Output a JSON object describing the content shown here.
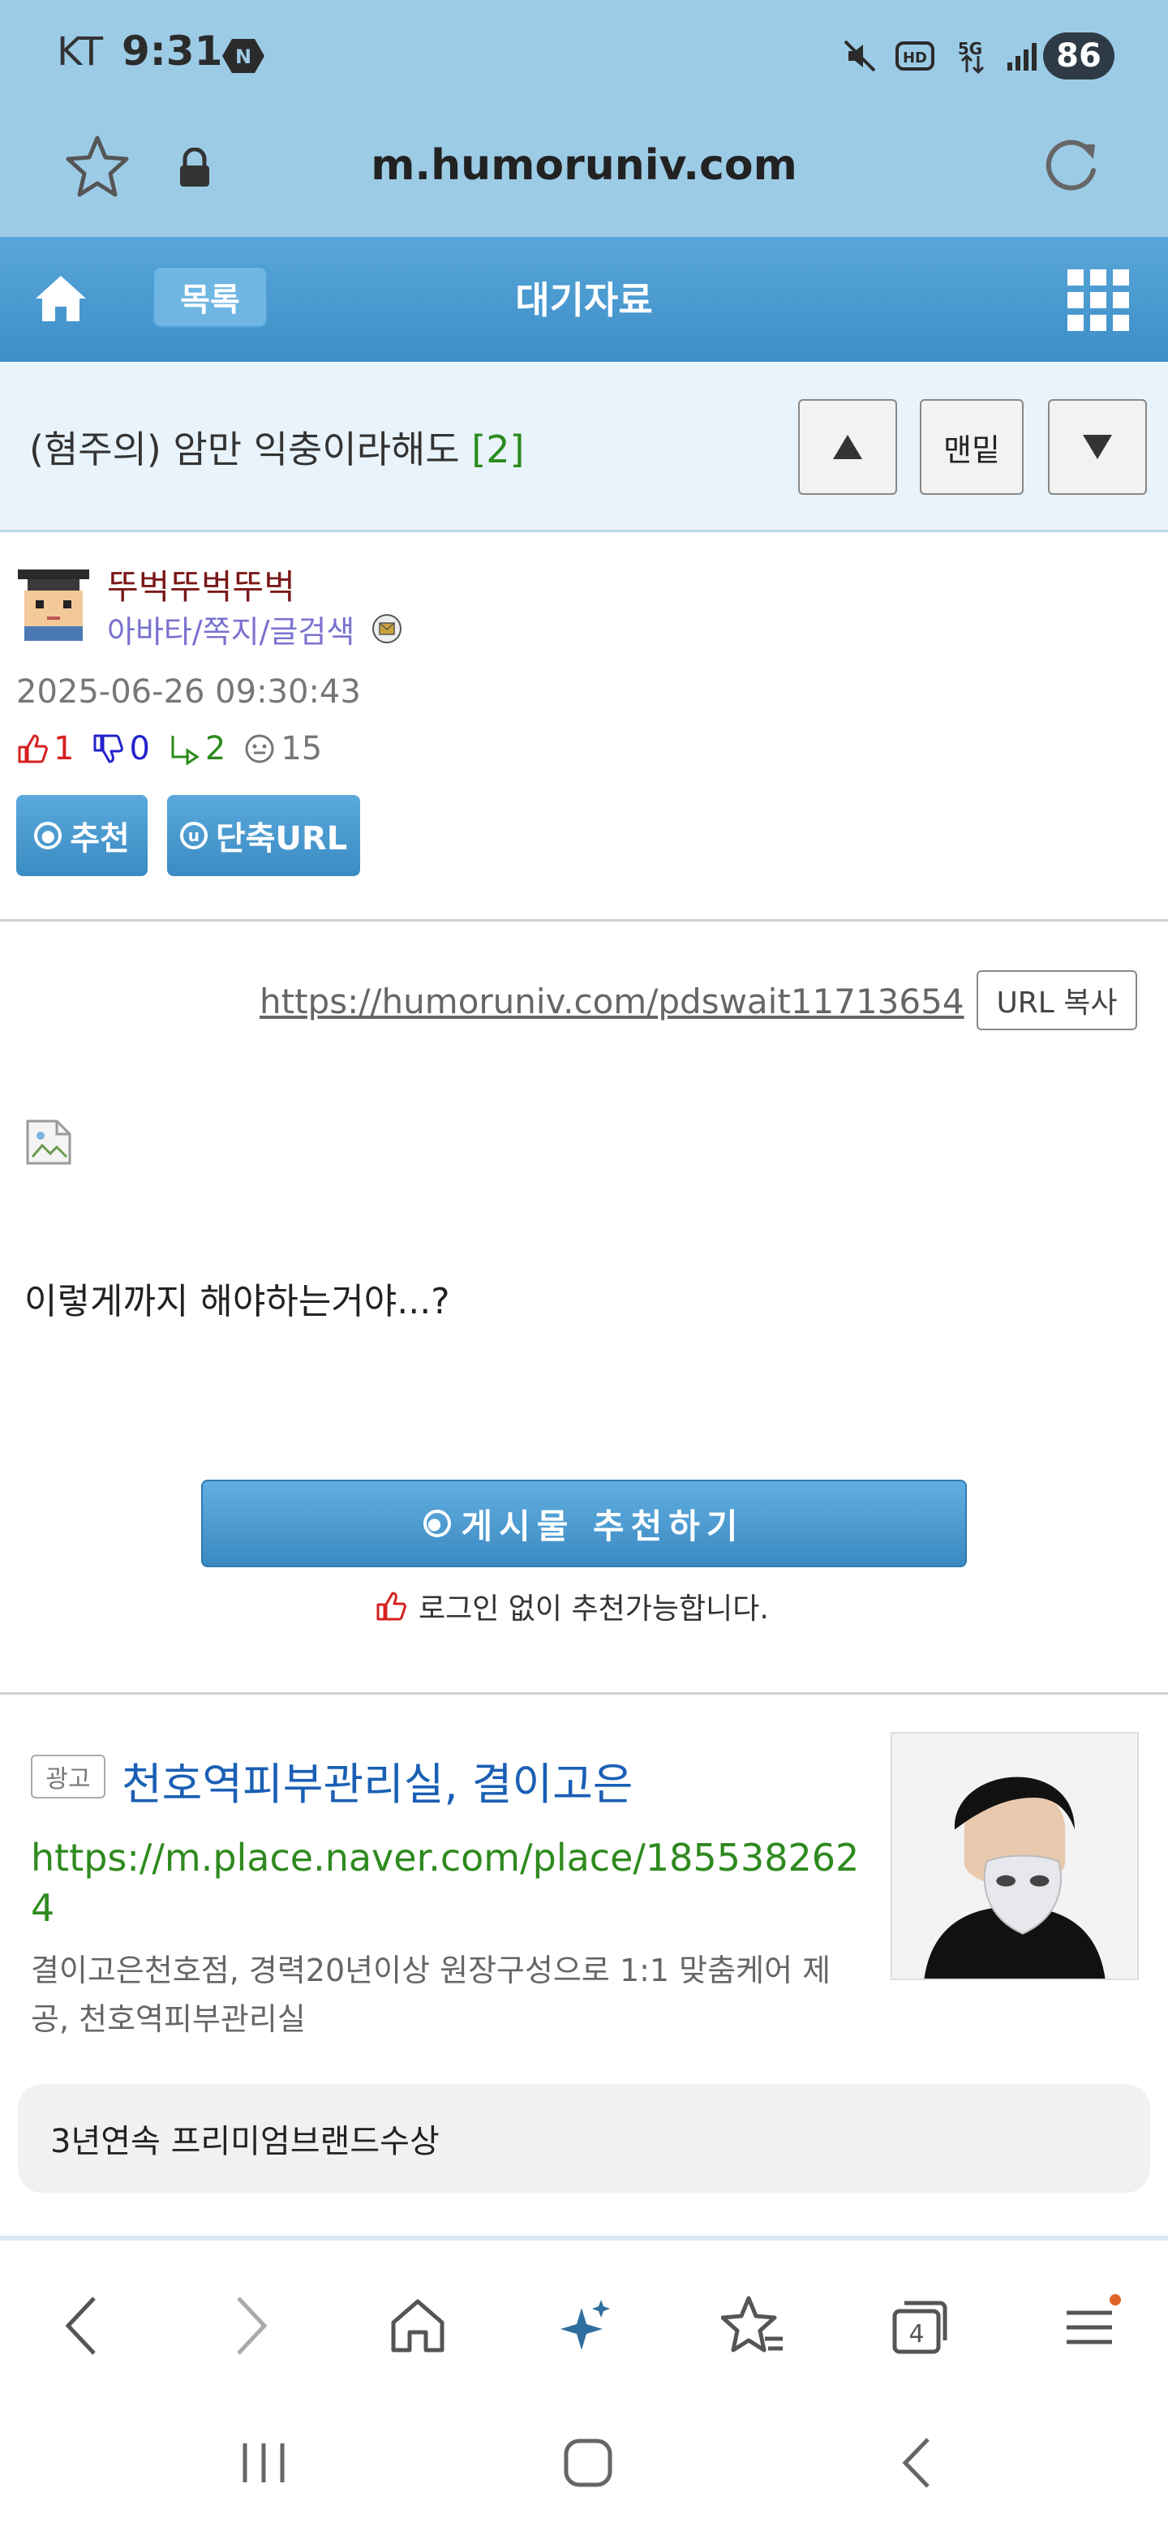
{
  "status_bar": {
    "carrier": "KT",
    "time": "9:31",
    "battery": "86",
    "icons": [
      "n-badge-icon",
      "mute-icon",
      "hd-icon",
      "5g-icon",
      "signal-icon",
      "battery-icon"
    ]
  },
  "browser": {
    "url": "m.humoruniv.com",
    "tab_count": "4"
  },
  "site_nav": {
    "list_label": "목록",
    "board_title": "대기자료"
  },
  "post": {
    "title": "(혐주의) 암만 익충이라해도",
    "comment_count": "[2]",
    "nav_bottom_label": "맨밑",
    "author_name": "뚜벅뚜벅뚜벅",
    "author_links": "아바타/쪽지/글검색",
    "date": "2025-06-26 09:30:43",
    "stats": {
      "up": "1",
      "down": "0",
      "replies": "2",
      "views": "15"
    },
    "recommend_label": "추천",
    "short_url_label": "단축URL",
    "url": "https://humoruniv.com/pdswait11713654",
    "copy_url_label": "URL 복사",
    "body_text": "이렇게까지 해야하는거야...?",
    "big_recommend_label": "게시물 추천하기",
    "login_note": "로그인 없이 추천가능합니다."
  },
  "ad": {
    "badge": "광고",
    "title": "천호역피부관리실, 결이고은",
    "url": "https://m.place.naver.com/place/1855382624",
    "description": "결이고은천호점, 경력20년이상 원장구성으로 1:1 맞춤케어 제공, 천호역피부관리실",
    "chip": "3년연속 프리미엄브랜드수상"
  },
  "colors": {
    "chrome": "#9ccbe6",
    "nav_blue": "#3d8fc9",
    "author_name": "#7a1818",
    "link_purple": "#7a72cf",
    "ad_title": "#1a5fb4",
    "ad_url": "#2e8a1e"
  }
}
